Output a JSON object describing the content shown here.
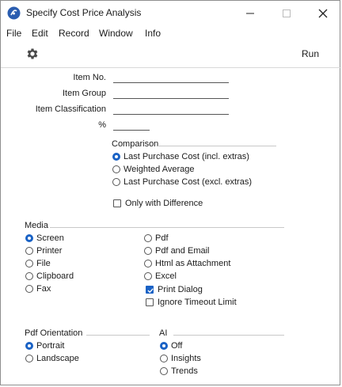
{
  "window": {
    "title": "Specify Cost Price Analysis"
  },
  "menu": [
    "File",
    "Edit",
    "Record",
    "Window",
    "Info"
  ],
  "toolbar": {
    "run_label": "Run"
  },
  "fields": {
    "item_no": "Item No.",
    "item_group": "Item Group",
    "item_classification": "Item Classification",
    "percent": "%"
  },
  "comparison": {
    "title": "Comparison",
    "options": [
      "Last Purchase Cost (incl. extras)",
      "Weighted Average",
      "Last Purchase Cost (excl. extras)"
    ],
    "selected": 0
  },
  "only_with_difference": {
    "label": "Only with Difference",
    "checked": false
  },
  "media": {
    "title": "Media",
    "left_options": [
      "Screen",
      "Printer",
      "File",
      "Clipboard",
      "Fax"
    ],
    "right_options": [
      "Pdf",
      "Pdf and Email",
      "Html as Attachment",
      "Excel"
    ],
    "selected": "Screen",
    "print_dialog": {
      "label": "Print Dialog",
      "checked": true
    },
    "ignore_timeout": {
      "label": "Ignore Timeout Limit",
      "checked": false
    }
  },
  "pdf_orientation": {
    "title": "Pdf Orientation",
    "options": [
      "Portrait",
      "Landscape"
    ],
    "selected": 0
  },
  "ai": {
    "title": "AI",
    "options": [
      "Off",
      "Insights",
      "Trends"
    ],
    "selected": 0
  },
  "colors": {
    "accent": "#1a62c5"
  }
}
